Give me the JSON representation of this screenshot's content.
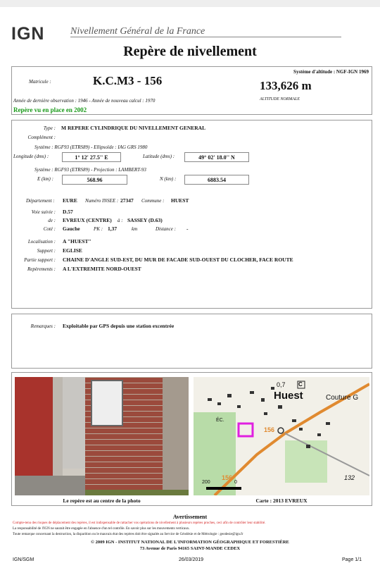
{
  "header": {
    "logo_text": "IGN",
    "subtitle": "Nivellement Général de la France",
    "title": "Repère de nivellement"
  },
  "identity": {
    "matricule_label": "Matricule :",
    "matricule": "K.C.M3 - 156",
    "systeme_altitude": "Système d'altitude : NGF-IGN 1969",
    "altitude": "133,626 m",
    "altitude_label": "ALTITUDE NORMALE",
    "observation": "Année de dernière observation : 1946 - Année de nouveau calcul : 1970",
    "status": "Repère vu en place en 2002"
  },
  "details": {
    "type_label": "Type :",
    "type_value": "M  REPERE CYLINDRIQUE DU NIVELLEMENT GENERAL",
    "complement_label": "Complément :",
    "systeme_geo": "Système : RGF93 (ETRS89) - Ellipsoïde : IAG GRS 1980",
    "longitude_label": "Longitude (dms) :",
    "longitude": "1°  12'  27.5'' E",
    "latitude_label": "Latitude (dms) :",
    "latitude": "49°  02'  18.0'' N",
    "systeme_proj": "Système : RGF93 (ETRS89) - Projection : LAMBERT-93",
    "e_label": "E (km) :",
    "e_value": "568.96",
    "n_label": "N (km) :",
    "n_value": "6883.54",
    "departement_label": "Département :",
    "departement": "EURE",
    "insee_label": "Numéro INSEE :",
    "insee": "27347",
    "commune_label": "Commune :",
    "commune": "HUEST",
    "voie_label": "Voie suivie :",
    "voie": "D.57",
    "de_label": "de :",
    "de": "EVREUX (CENTRE)",
    "a_label": "à :",
    "a": "SASSEY (D.63)",
    "cote_label": "Coté :",
    "cote": "Gauche",
    "pk_label": "PK :",
    "pk": "1,37",
    "km": "km",
    "distance_label": "Distance :",
    "distance": "-",
    "localisation_label": "Localisation :",
    "localisation": "A \"HUEST\"",
    "support_label": "Support :",
    "support": "EGLISE",
    "partie_label": "Partie support :",
    "partie": "CHAINE D'ANGLE SUD-EST, DU MUR DE FACADE SUD-OUEST DU CLOCHER, FACE ROUTE",
    "reperements_label": "Repèrements :",
    "reperements": "A L'EXTREMITE NORD-OUEST"
  },
  "remarques": {
    "label": "Remarques :",
    "value": "Exploitable par GPS depuis une station excentrée"
  },
  "photo": {
    "caption": "Le repère est au centre de la photo"
  },
  "map": {
    "caption": "Carte : 2013 EVREUX",
    "town": "Huest",
    "place": "Couture G",
    "elev1": "0,7",
    "elev2": "132",
    "elev3": "156",
    "elev4": "156",
    "ec": "ÉC.",
    "c_box": "C",
    "scale0": "200",
    "scale1": "0"
  },
  "warning": {
    "title": "Avertissement",
    "red_line": "Compte-tenu des risques de déplacement des repères, il est indispensable de rattacher vos opérations de nivellement à plusieurs repères proches, ceci afin de contrôler leur stabilité.",
    "line2": "La responsabilité de l'IGN ne saurait être engagée en l'absence d'un tel contrôle.  En savoir plus sur les mouvements verticaux.",
    "line3": "Toute remarque concernant la destruction, la disparition ou le mauvais état des repères doit être signalée au Service de Géodésie et de Métrologie : geodesie@ign.fr",
    "copyright": "© 2009 IGN - INSTITUT NATIONAL DE L'INFORMATION GÉOGRAPHIQUE ET FORESTIÈRE",
    "address": "73 Avenue de Paris 94165 SAINT-MANDE CEDEX"
  },
  "footer": {
    "left": "IGN/SGM",
    "date": "26/03/2019",
    "page": "Page 1/1"
  },
  "colors": {
    "green": "#1a9a1a",
    "red": "#d42020",
    "magenta": "#e020e0",
    "orange": "#e08a30"
  }
}
